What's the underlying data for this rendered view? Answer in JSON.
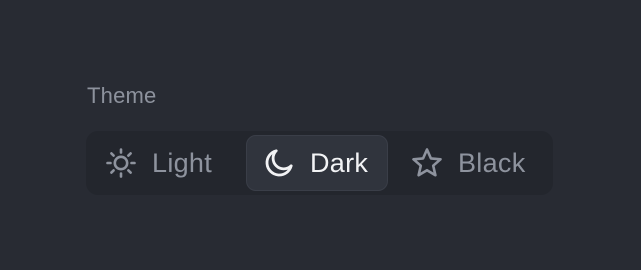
{
  "settings": {
    "theme_label": "Theme",
    "options": [
      {
        "label": "Light",
        "icon": "sun-icon",
        "selected": false
      },
      {
        "label": "Dark",
        "icon": "moon-icon",
        "selected": true
      },
      {
        "label": "Black",
        "icon": "star-icon",
        "selected": false
      }
    ]
  },
  "colors": {
    "background": "#282b33",
    "control_background": "#23262d",
    "selected_background": "#30343d",
    "selected_text": "#f2f3f5",
    "muted_text": "#8e939e"
  }
}
